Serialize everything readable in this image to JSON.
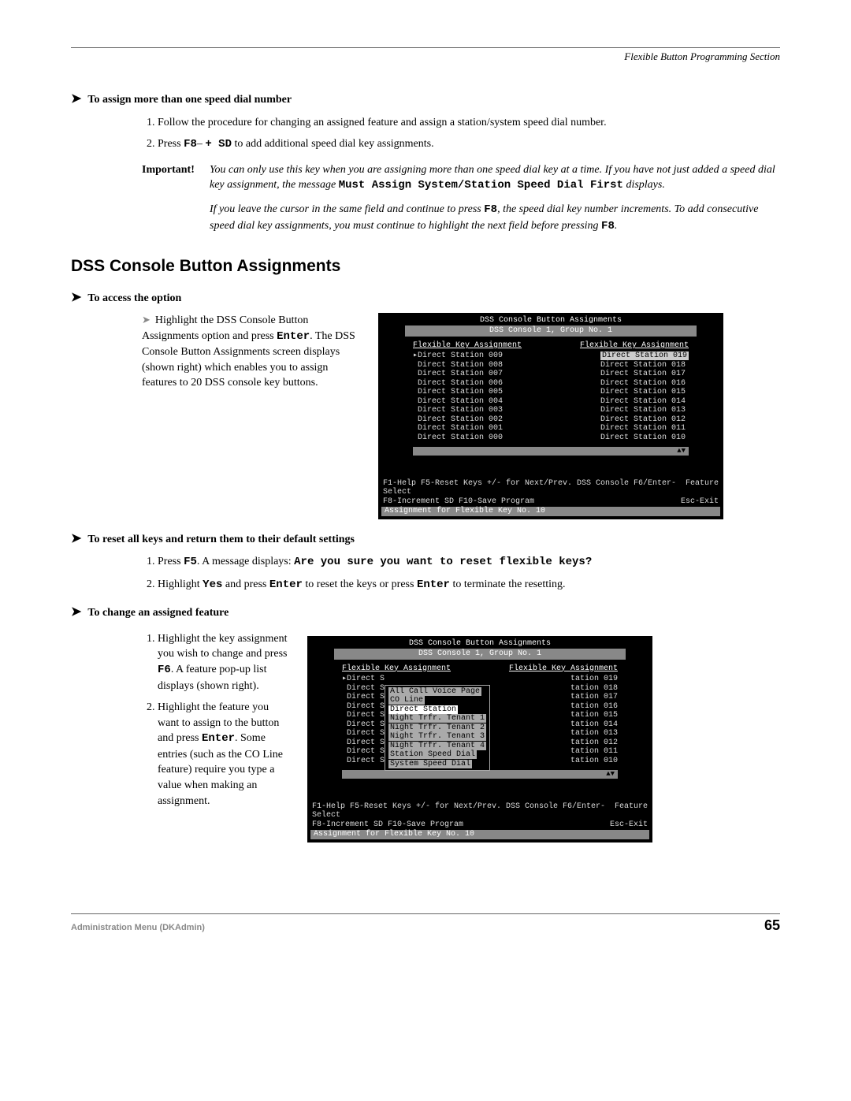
{
  "header": {
    "section_title": "Flexible Button Programming Section"
  },
  "h1": {
    "title": "To assign more than one speed dial number"
  },
  "list1": {
    "i1": "Follow the procedure for changing an assigned feature and assign a station/system speed dial number.",
    "i2a": "Press ",
    "i2key": "F8",
    "i2b": "– ",
    "i2key2": "+ SD",
    "i2c": " to add additional speed dial key assignments."
  },
  "important": {
    "label": "Important!",
    "p1a": "You can only use this key when you are assigning more than one speed dial key at a time. If you have not just added a speed dial key assignment, the message ",
    "p1m": "Must Assign System/Station Speed Dial First",
    "p1b": " displays."
  },
  "para_indent": {
    "a": "If you leave the cursor in the same field and continue to press ",
    "k1": "F8",
    "b": ", the speed dial key number increments. To add consecutive speed dial key assignments, you must continue to highlight the next field before pressing ",
    "k2": "F8",
    "c": "."
  },
  "h2": {
    "title": "DSS Console Button Assignments"
  },
  "h3": {
    "title": "To access the option"
  },
  "access_text": {
    "a": "Highlight the DSS Console Button Assignments option and press ",
    "k": "Enter",
    "b": ". The DSS Console Button Assignments screen displays (shown right) which enables you to assign features to 20 DSS console key buttons."
  },
  "terminal1": {
    "title": "DSS Console Button Assignments",
    "subtitle": "DSS Console 1, Group No. 1",
    "col_header": "Flexible Key Assignment",
    "left": [
      "Direct Station 009",
      "Direct Station 008",
      "Direct Station 007",
      "Direct Station 006",
      "Direct Station 005",
      "Direct Station 004",
      "Direct Station 003",
      "Direct Station 002",
      "Direct Station 001",
      "Direct Station 000"
    ],
    "right": [
      "Direct Station 019",
      "Direct Station 018",
      "Direct Station 017",
      "Direct Station 016",
      "Direct Station 015",
      "Direct Station 014",
      "Direct Station 013",
      "Direct Station 012",
      "Direct Station 011",
      "Direct Station 010"
    ],
    "footer1l": "F1-Help  F5-Reset Keys  +/- for Next/Prev. DSS Console  F6/Enter-Select",
    "footer1r": "Feature",
    "footer2l": "F8-Increment SD  F10-Save Program",
    "footer2r": "Esc-Exit",
    "status": "Assignment for Flexible Key No. 10",
    "scroll": "▲▼"
  },
  "h4": {
    "title": "To reset all keys and return them to their default settings"
  },
  "list2": {
    "i1a": "Press ",
    "i1k": "F5",
    "i1b": ". A message displays: ",
    "i1m": "Are you sure you want to reset flexible keys?",
    "i2a": "Highlight ",
    "i2k1": "Yes",
    "i2b": " and press ",
    "i2k2": "Enter",
    "i2c": " to reset the keys or press ",
    "i2k3": "Enter",
    "i2d": " to terminate the resetting."
  },
  "h5": {
    "title": "To change an assigned feature"
  },
  "list3": {
    "i1a": "Highlight the key assignment you wish to change and press ",
    "i1k": "F6",
    "i1b": ". A feature pop-up list displays (shown right).",
    "i2a": "Highlight the feature you want to assign to the button and press ",
    "i2k": "Enter",
    "i2b": ". Some entries (such as the CO Line feature) require you type a value when making an assignment."
  },
  "terminal2": {
    "title": "DSS Console Button Assignments",
    "subtitle": "DSS Console 1, Group No. 1",
    "col_header": "Flexible Key Assignment",
    "left_prefix": "Direct S",
    "popup": [
      "All Call Voice Page",
      "CO Line",
      "Direct Station",
      "Night Trfr. Tenant 1",
      "Night Trfr. Tenant 2",
      "Night Trfr. Tenant 3",
      "Night Trfr. Tenant 4",
      "Station Speed Dial",
      "System Speed Dial"
    ],
    "right": [
      "tation 019",
      "tation 018",
      "tation 017",
      "tation 016",
      "tation 015",
      "tation 014",
      "tation 013",
      "tation 012",
      "tation 011",
      "tation 010"
    ],
    "footer1l": "F1-Help  F5-Reset Keys  +/- for Next/Prev. DSS Console  F6/Enter-Select",
    "footer1r": "Feature",
    "footer2l": "F8-Increment SD  F10-Save Program",
    "footer2r": "Esc-Exit",
    "status": "Assignment for Flexible Key No. 10",
    "scroll": "▲▼"
  },
  "footer": {
    "left": "Administration Menu (DKAdmin)",
    "page": "65"
  }
}
